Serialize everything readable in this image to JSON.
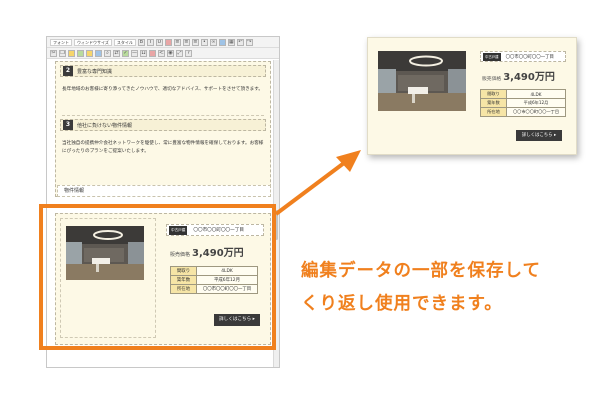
{
  "editor": {
    "toolbar": {
      "format_label": "フォント",
      "size_label": "ウィンドウサイズ",
      "style_label": "スタイル"
    },
    "service_items": [
      {
        "number": "2",
        "title": "豊富な専門知識",
        "body": "長年地域のお客様に寄り添ってきたノウハウで、適切なアドバイス、サポートをさせて頂きます。"
      },
      {
        "number": "3",
        "title": "他社に負けない物件情報",
        "body": "当社独自の提携仲介会社ネットワークを駆使し、常に豊富な物件情報を確保しております。お客様にぴったりのプランをご提案いたします。"
      }
    ],
    "property_section_title": "物件情報"
  },
  "listing": {
    "area_badge": "中古戸建",
    "address_short": "〇〇市〇〇町〇〇一丁目",
    "price_label": "販売価格",
    "price_value": "3,490万円",
    "specs": [
      {
        "label": "間取り",
        "value": "4LDK"
      },
      {
        "label": "築年数",
        "value": "平成6年12月"
      },
      {
        "label": "所在地",
        "value": "〇〇市〇〇町〇〇一丁目"
      }
    ],
    "detail_button": "詳しくはこちら ▸"
  },
  "caption": {
    "line1": "編集データの一部を保存して",
    "line2": "くり返し使用できます。"
  },
  "colors": {
    "accent": "#f0801e",
    "card_bg": "#fdf9e6",
    "label_bg": "#f6e5a6"
  }
}
